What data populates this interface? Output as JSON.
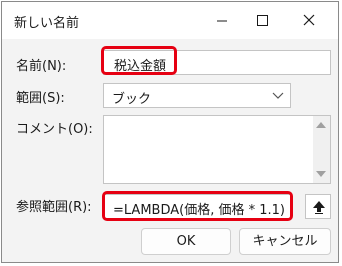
{
  "dialog": {
    "title": "新しい名前",
    "controls": {
      "minimize": "minimize-icon",
      "maximize": "maximize-icon",
      "close": "close-icon"
    }
  },
  "form": {
    "name_label": "名前(N):",
    "name_value": "税込金額",
    "scope_label": "範囲(S):",
    "scope_value": "ブック",
    "comment_label": "コメント(O):",
    "comment_value": "",
    "ref_label": "参照範囲(R):",
    "ref_value": "=LAMBDA(価格, 価格 * 1.1)"
  },
  "buttons": {
    "ok": "OK",
    "cancel": "キャンセル"
  },
  "colors": {
    "highlight": "#e60012"
  }
}
